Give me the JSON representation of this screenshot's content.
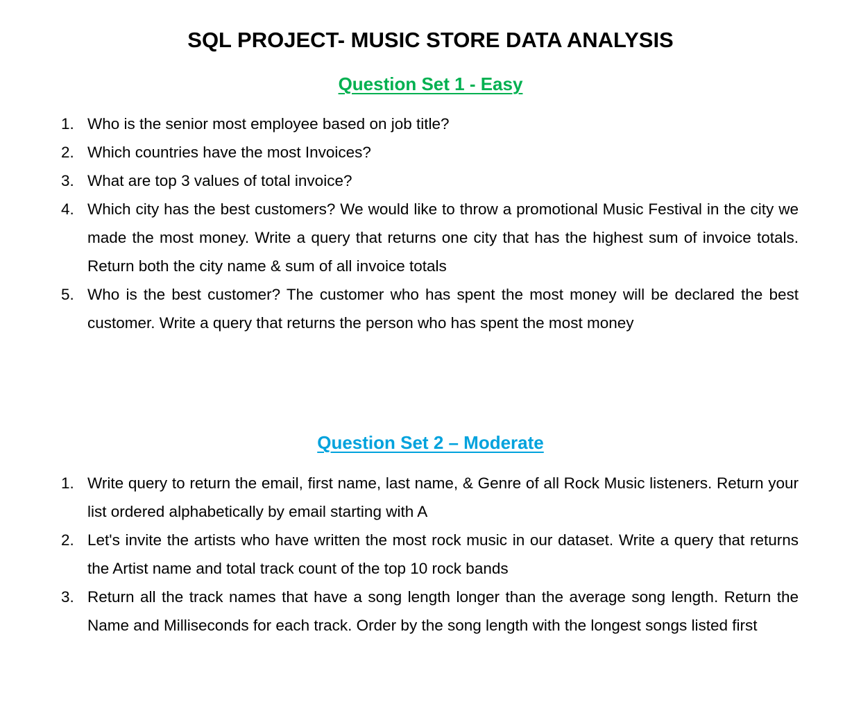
{
  "document": {
    "title": "SQL PROJECT- MUSIC STORE DATA ANALYSIS",
    "sections": [
      {
        "heading": "Question Set 1 - Easy",
        "heading_color": "#00b050",
        "questions": [
          {
            "number": "1.",
            "text": "Who is the senior most employee based on job title?"
          },
          {
            "number": "2.",
            "text": "Which countries have the most Invoices?"
          },
          {
            "number": "3.",
            "text": "What are top 3 values of total invoice?"
          },
          {
            "number": "4.",
            "text": "Which city has the best customers? We would like to throw a promotional Music Festival in the city we made the most money. Write a query that returns one city that has the highest sum of invoice totals. Return both the city name & sum of all invoice totals"
          },
          {
            "number": "5.",
            "text": "Who is the best customer? The customer who has spent the most money will be declared the best customer. Write a query that returns the person who has spent the most money"
          }
        ]
      },
      {
        "heading": "Question Set 2 – Moderate",
        "heading_color": "#00a2dd",
        "questions": [
          {
            "number": "1.",
            "text": "Write query to return the email, first name, last name, & Genre of all Rock Music listeners. Return your list ordered alphabetically by email starting with A"
          },
          {
            "number": "2.",
            "text": "Let's invite the artists who have written the most rock music in our dataset. Write a query that returns the Artist name and total track count of the top 10 rock bands"
          },
          {
            "number": "3.",
            "text": "Return all the track names that have a song length longer than the average song length. Return the Name and Milliseconds for each track. Order by the song length with the longest songs listed first"
          }
        ]
      }
    ]
  }
}
